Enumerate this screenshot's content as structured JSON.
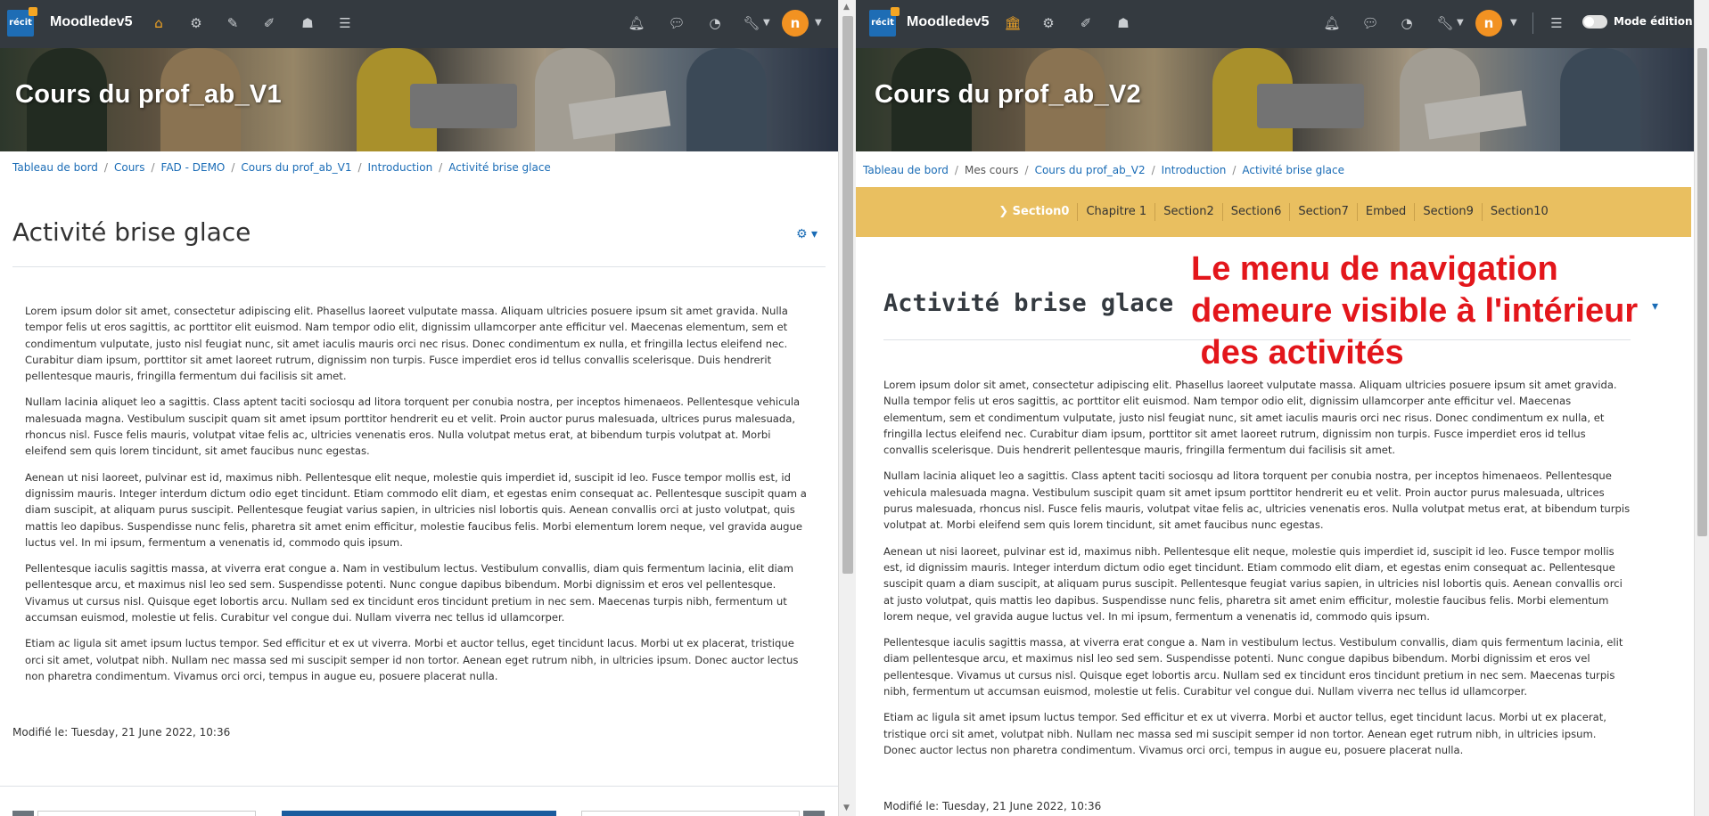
{
  "site_name": "Moodledev5",
  "logo_text": "récit",
  "avatar_initial": "n",
  "colors": {
    "navbar": "#343a40",
    "accent": "#f5a623",
    "link": "#1a6cb6",
    "section_bar": "#e9bf60",
    "annotation": "#e3161b"
  },
  "left": {
    "course_title": "Cours du prof_ab_V1",
    "breadcrumb": [
      "Tableau de bord",
      "Cours",
      "FAD - DEMO",
      "Cours du prof_ab_V1",
      "Introduction",
      "Activité brise glace"
    ],
    "page_title": "Activité brise glace",
    "modified": "Modifié le: Tuesday, 21 June 2022, 10:36"
  },
  "right": {
    "course_title": "Cours du prof_ab_V2",
    "breadcrumb": [
      "Tableau de bord",
      "Mes cours",
      "Cours du prof_ab_V2",
      "Introduction",
      "Activité brise glace"
    ],
    "page_title": "Activité brise glace",
    "edit_mode_label": "Mode édition",
    "sections": [
      "Section0",
      "Chapitre 1",
      "Section2",
      "Section6",
      "Section7",
      "Embed",
      "Section9",
      "Section10"
    ],
    "modified": "Modifié le: Tuesday, 21 June 2022, 10:36"
  },
  "paragraphs": [
    "Lorem ipsum dolor sit amet, consectetur adipiscing elit. Phasellus laoreet vulputate massa. Aliquam ultricies posuere ipsum sit amet gravida. Nulla tempor felis ut eros sagittis, ac porttitor elit euismod. Nam tempor odio elit, dignissim ullamcorper ante efficitur vel. Maecenas elementum, sem et condimentum vulputate, justo nisl feugiat nunc, sit amet iaculis mauris orci nec risus. Donec condimentum ex nulla, et fringilla lectus eleifend nec. Curabitur diam ipsum, porttitor sit amet laoreet rutrum, dignissim non turpis. Fusce imperdiet eros id tellus convallis scelerisque. Duis hendrerit pellentesque mauris, fringilla fermentum dui facilisis sit amet.",
    "Nullam lacinia aliquet leo a sagittis. Class aptent taciti sociosqu ad litora torquent per conubia nostra, per inceptos himenaeos. Pellentesque vehicula malesuada magna. Vestibulum suscipit quam sit amet ipsum porttitor hendrerit eu et velit. Proin auctor purus malesuada, ultrices purus malesuada, rhoncus nisl. Fusce felis mauris, volutpat vitae felis ac, ultricies venenatis eros. Nulla volutpat metus erat, at bibendum turpis volutpat at. Morbi eleifend sem quis lorem tincidunt, sit amet faucibus nunc egestas.",
    "Aenean ut nisi laoreet, pulvinar est id, maximus nibh. Pellentesque elit neque, molestie quis imperdiet id, suscipit id leo. Fusce tempor mollis est, id dignissim mauris. Integer interdum dictum odio eget tincidunt. Etiam commodo elit diam, et egestas enim consequat ac. Pellentesque suscipit quam a diam suscipit, at aliquam purus suscipit. Pellentesque feugiat varius sapien, in ultricies nisl lobortis quis. Aenean convallis orci at justo volutpat, quis mattis leo dapibus. Suspendisse nunc felis, pharetra sit amet enim efficitur, molestie faucibus felis. Morbi elementum lorem neque, vel gravida augue luctus vel. In mi ipsum, fermentum a venenatis id, commodo quis ipsum.",
    "Pellentesque iaculis sagittis massa, at viverra erat congue a. Nam in vestibulum lectus. Vestibulum convallis, diam quis fermentum lacinia, elit diam pellentesque arcu, et maximus nisl leo sed sem. Suspendisse potenti. Nunc congue dapibus bibendum. Morbi dignissim et eros vel pellentesque. Vivamus ut cursus nisl. Quisque eget lobortis arcu. Nullam sed ex tincidunt eros tincidunt pretium in nec sem. Maecenas turpis nibh, fermentum ut accumsan euismod, molestie ut felis. Curabitur vel congue dui. Nullam viverra nec tellus id ullamcorper.",
    "Etiam ac ligula sit amet ipsum luctus tempor. Sed efficitur et ex ut viverra. Morbi et auctor tellus, eget tincidunt lacus. Morbi ut ex placerat, tristique orci sit amet, volutpat nibh. Nullam nec massa sed mi suscipit semper id non tortor. Aenean eget rutrum nibh, in ultricies ipsum. Donec auctor lectus non pharetra condimentum. Vivamus orci orci, tempus in augue eu, posuere placerat nulla."
  ],
  "annotation": [
    "Le menu de navigation",
    "demeure visible à l'intérieur",
    " des activités"
  ]
}
